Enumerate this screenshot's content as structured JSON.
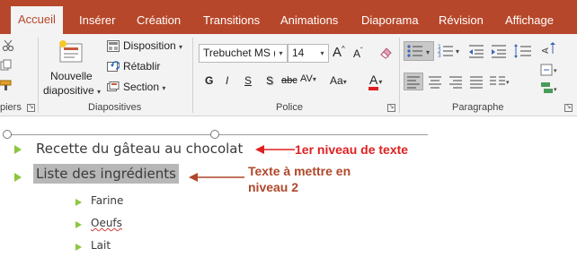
{
  "tabs": [
    {
      "label": "Accueil",
      "active": true
    },
    {
      "label": "Insérer"
    },
    {
      "label": "Création"
    },
    {
      "label": "Transitions"
    },
    {
      "label": "Animations"
    },
    {
      "label": "Diaporama"
    },
    {
      "label": "Révision"
    },
    {
      "label": "Affichage"
    }
  ],
  "ribbon": {
    "clipboard": {
      "group_label": "piers"
    },
    "slides": {
      "new_slide_line1": "Nouvelle",
      "new_slide_line2": "diapositive",
      "layout": "Disposition",
      "reset": "Rétablir",
      "section": "Section",
      "group_label": "Diapositives"
    },
    "font": {
      "font_name": "Trebuchet MS (",
      "font_size": "14",
      "grow": "A",
      "shrink": "A",
      "bold": "G",
      "italic": "I",
      "underline": "S",
      "shadow": "S",
      "strike": "abc",
      "spacing": "AV",
      "case": "Aa",
      "color": "A",
      "group_label": "Police"
    },
    "paragraph": {
      "group_label": "Paragraphe"
    },
    "colors": {
      "tab_bg": "#b7472a",
      "ribbon_bg": "#f3f3f3",
      "bullet": "#8dc63f",
      "annotation_red": "#e02020",
      "annotation_brown": "#b0472a"
    }
  },
  "slide": {
    "level1": [
      "Recette du gâteau au chocolat",
      "Liste des ingrédients"
    ],
    "level2": [
      "Farine",
      "Oeufs",
      "Lait"
    ],
    "annotation1": "1er niveau de texte",
    "annotation2_line1": "Texte à mettre en",
    "annotation2_line2": "niveau 2"
  }
}
